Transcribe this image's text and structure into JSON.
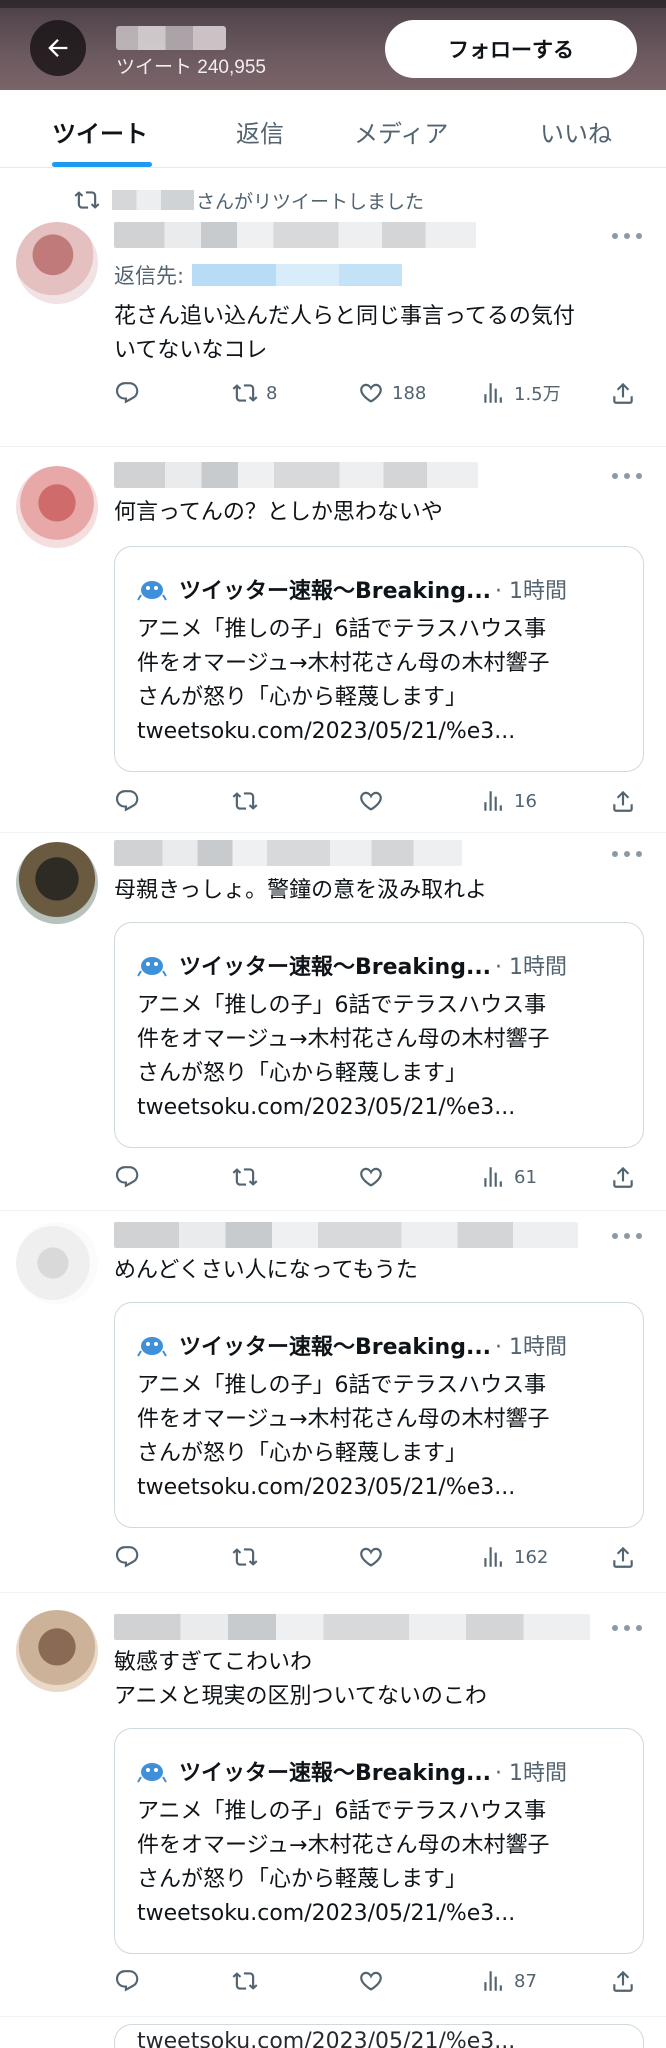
{
  "header": {
    "tweet_count": "ツイート 240,955",
    "follow_label": "フォローする"
  },
  "tabs": [
    {
      "label": "ツイート",
      "active": true
    },
    {
      "label": "返信",
      "active": false
    },
    {
      "label": "メディア",
      "active": false
    },
    {
      "label": "いいね",
      "active": false
    }
  ],
  "retweet_notice": "さんがリツイートしました",
  "reply_to_label": "返信先:",
  "colors": {
    "accent": "#1d9bf0",
    "text": "#0f1419",
    "muted": "#536471"
  },
  "icons": {
    "back": "arrow-left-icon",
    "retweet": "retweet-icon",
    "reply": "reply-icon",
    "like": "heart-icon",
    "views": "bar-chart-icon",
    "share": "share-icon",
    "more": "more-icon"
  },
  "card": {
    "name": "ツイッター速報〜Breaking...",
    "time": "· 1時間",
    "line1": "アニメ「推しの子」6話でテラスハウス事",
    "line2": "件をオマージュ→木村花さん母の木村響子",
    "line3": "さんが怒り「心から軽蔑します」",
    "url": "tweetsoku.com/2023/05/21/%e3..."
  },
  "tweets": [
    {
      "text_lines": [
        "花さん追い込んだ人らと同じ事言ってるの気付",
        "いてないなコレ"
      ],
      "replies": "",
      "retweets": "8",
      "likes": "188",
      "views": "1.5万"
    },
    {
      "text_lines": [
        "何言ってんの？としか思わないや"
      ],
      "replies": "",
      "retweets": "",
      "likes": "",
      "views": "16"
    },
    {
      "text_lines": [
        "母親きっしょ。警鐘の意を汲み取れよ"
      ],
      "replies": "",
      "retweets": "",
      "likes": "",
      "views": "61"
    },
    {
      "text_lines": [
        "めんどくさい人になってもうた"
      ],
      "replies": "",
      "retweets": "",
      "likes": "",
      "views": "162"
    },
    {
      "text_lines": [
        "敏感すぎてこわいわ",
        "アニメと現実の区別ついてないのこわ"
      ],
      "replies": "",
      "retweets": "",
      "likes": "",
      "views": "87"
    }
  ],
  "bottom_partial": "tweetsoku.com/2023/05/21/%e3..."
}
